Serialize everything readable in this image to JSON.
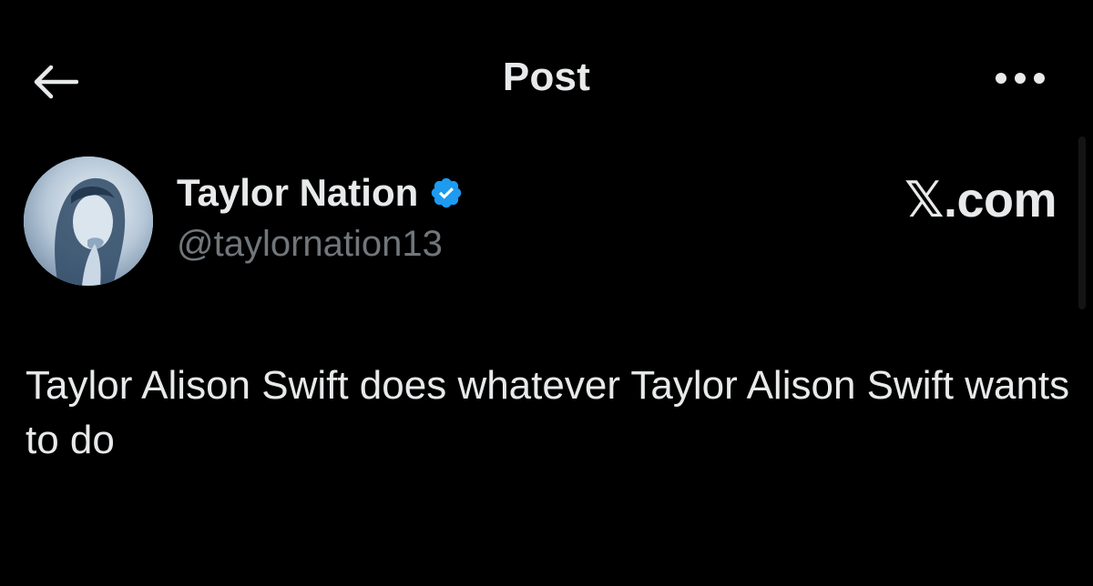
{
  "header": {
    "title": "Post",
    "back_icon": "arrow-left-icon",
    "more_icon": "more-horizontal-icon"
  },
  "author": {
    "display_name": "Taylor Nation",
    "handle": "@taylornation13",
    "verified_icon": "verified-badge-icon",
    "verified_color": "#1d9bf0"
  },
  "watermark": "𝕏.com",
  "post": {
    "text": "Taylor Alison Swift does whatever Taylor Alison Swift wants to do"
  },
  "colors": {
    "background": "#000000",
    "primary_text": "#e7e9ea",
    "secondary_text": "#71767b"
  }
}
